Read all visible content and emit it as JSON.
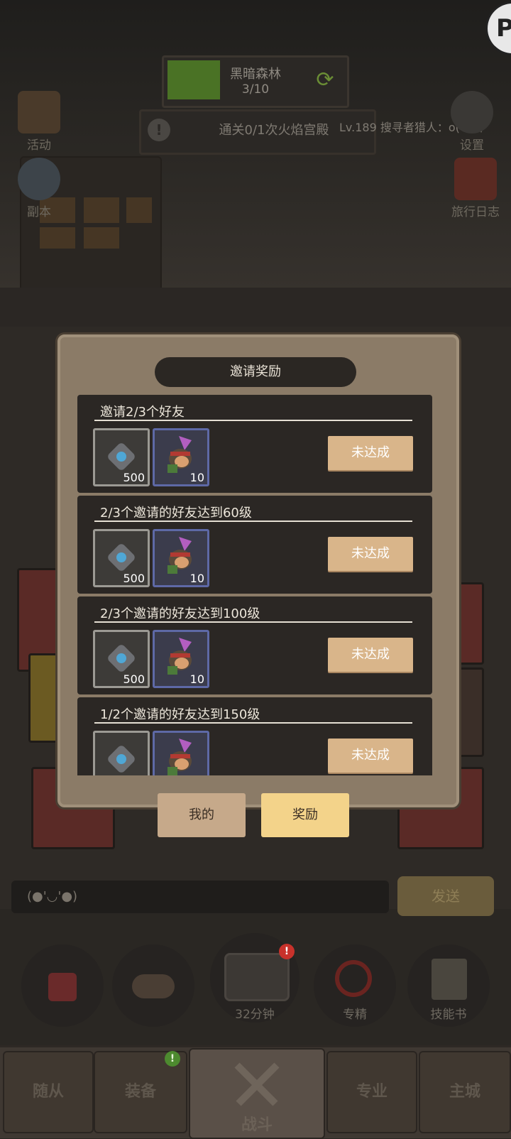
{
  "hud": {
    "stage_name": "黑暗森林",
    "stage_progress": "3/10",
    "quest_text": "通关0/1次火焰宫殿",
    "ticker_text": "Lv.189 搜寻者猎人：o(*￣▽",
    "left_buttons": [
      {
        "label": "活动",
        "icon": "scroll-icon"
      },
      {
        "label": "副本",
        "icon": "portal-icon"
      }
    ],
    "right_buttons": [
      {
        "label": "设置",
        "icon": "gear-icon"
      },
      {
        "label": "旅行日志",
        "icon": "book-icon"
      }
    ],
    "top_right_icon": "P"
  },
  "modal": {
    "title": "邀请奖励",
    "rewards": [
      {
        "title": "邀请2/3个好友",
        "item1_qty": "500",
        "item2_qty": "10",
        "status": "未达成"
      },
      {
        "title": "2/3个邀请的好友达到60级",
        "item1_qty": "500",
        "item2_qty": "10",
        "status": "未达成"
      },
      {
        "title": "2/3个邀请的好友达到100级",
        "item1_qty": "500",
        "item2_qty": "10",
        "status": "未达成"
      },
      {
        "title": "1/2个邀请的好友达到150级",
        "item1_qty": "",
        "item2_qty": "",
        "status": "未达成"
      }
    ]
  },
  "tabs": {
    "mine": "我的",
    "reward": "奖励",
    "active": "reward"
  },
  "chat": {
    "input_value": "(●'◡'●)",
    "send_label": "发送"
  },
  "actions": {
    "chest_timer": "32分钟",
    "specialty_label": "专精",
    "skillbook_label": "技能书"
  },
  "nav": {
    "follower": "随从",
    "equipment": "装备",
    "battle": "战斗",
    "profession": "专业",
    "main_city": "主城"
  },
  "colors": {
    "modal_bg": "#8b7b67",
    "card_bg": "#2b2724",
    "status_btn": "#d9b58a",
    "tab_active": "#f3d38a",
    "tab_inactive": "#c6a98a",
    "badge_red": "#c8322b",
    "badge_green": "#4d8a2f"
  }
}
